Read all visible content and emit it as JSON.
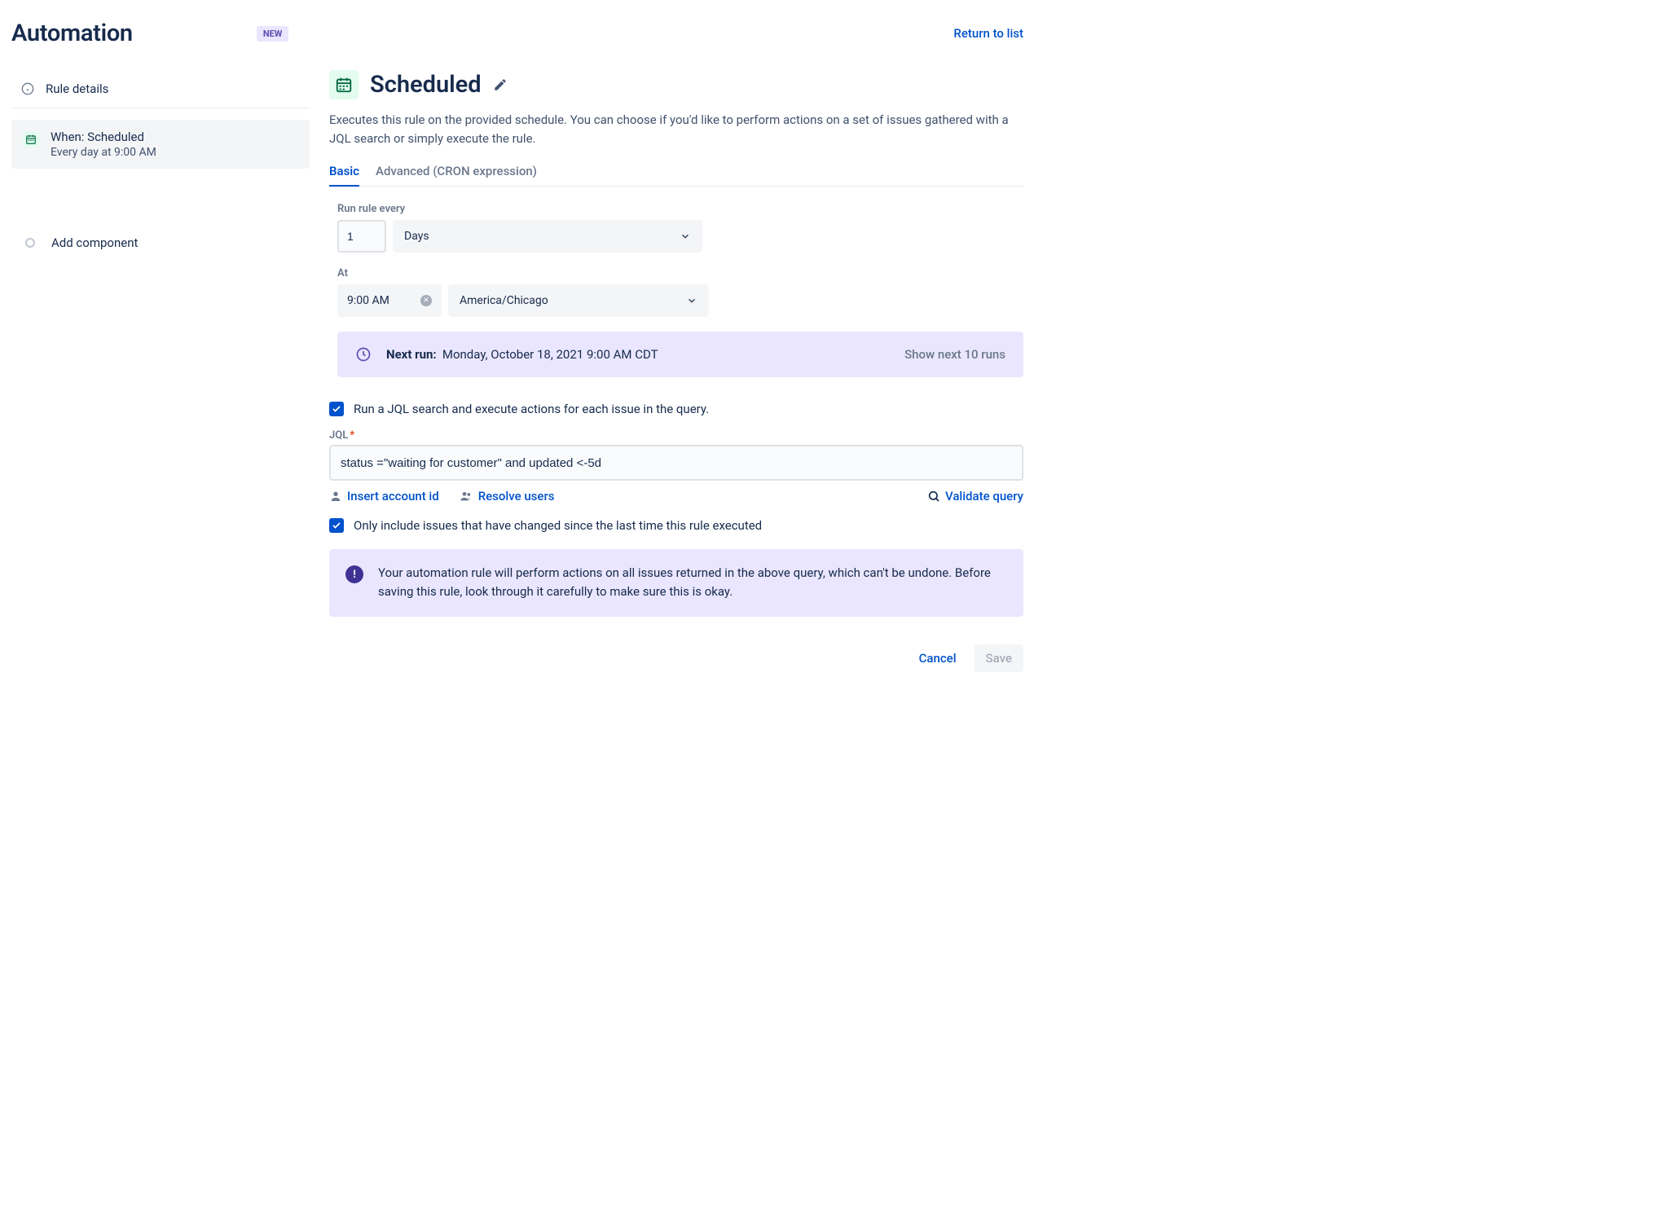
{
  "header": {
    "title": "Automation",
    "badge": "NEW",
    "return_link": "Return to list"
  },
  "sidebar": {
    "rule_details": "Rule details",
    "trigger": {
      "title": "When: Scheduled",
      "subtitle": "Every day at 9:00 AM"
    },
    "add_component": "Add component"
  },
  "main": {
    "title": "Scheduled",
    "description": "Executes this rule on the provided schedule. You can choose if you'd like to perform actions on a set of issues gathered with a JQL search or simply execute the rule.",
    "tabs": {
      "basic": "Basic",
      "advanced": "Advanced (CRON expression)"
    },
    "form": {
      "run_every_label": "Run rule every",
      "interval_value": "1",
      "unit": "Days",
      "at_label": "At",
      "time_value": "9:00 AM",
      "timezone": "America/Chicago"
    },
    "next_run": {
      "label": "Next run:",
      "value": "Monday, October 18, 2021 9:00 AM CDT",
      "show_next": "Show next 10 runs"
    },
    "jql_checkbox": "Run a JQL search and execute actions for each issue in the query.",
    "jql_label": "JQL",
    "jql_value": "status =\"waiting for customer\" and updated <-5d",
    "actions": {
      "insert_account": "Insert account id",
      "resolve_users": "Resolve users",
      "validate_query": "Validate query"
    },
    "only_changed_checkbox": "Only include issues that have changed since the last time this rule executed",
    "info_banner": "Your automation rule will perform actions on all issues returned in the above query, which can't be undone. Before saving this rule, look through it carefully to make sure this is okay.",
    "buttons": {
      "cancel": "Cancel",
      "save": "Save"
    }
  }
}
